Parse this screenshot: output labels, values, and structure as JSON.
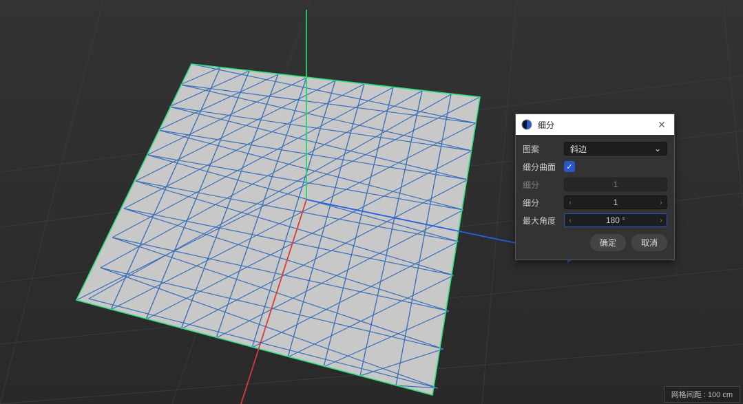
{
  "dialog": {
    "app_icon": "◐",
    "title": "细分",
    "fields": {
      "pattern_label": "图案",
      "pattern_value": "斜边",
      "subd_surface_label": "细分曲面",
      "subd_surface_checked": true,
      "subd1_label": "细分",
      "subd1_value": "1",
      "subd2_label": "细分",
      "subd2_value": "1",
      "max_angle_label": "最大角度",
      "max_angle_value": "180 °"
    },
    "buttons": {
      "ok": "确定",
      "cancel": "取消"
    }
  },
  "statusbar": {
    "grid_spacing_label": "网格间距 : ",
    "grid_spacing_value": "100 cm"
  }
}
